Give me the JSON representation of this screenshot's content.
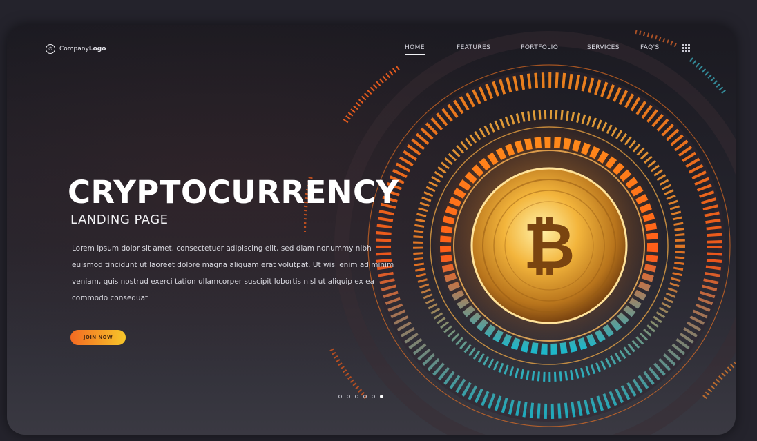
{
  "logo": {
    "text_regular": "Company",
    "text_bold": "Logo",
    "icon": "clock-icon"
  },
  "nav": {
    "items": [
      {
        "label": "HOME",
        "active": true
      },
      {
        "label": "FEATURES",
        "active": false
      },
      {
        "label": "PORTFOLIO",
        "active": false
      },
      {
        "label": "SERVICES",
        "active": false
      },
      {
        "label": "FAQ'S",
        "active": false
      }
    ],
    "menu_icon": "grid-icon"
  },
  "hero": {
    "title": "CRYPTOCURRENCY",
    "subtitle": "LANDING PAGE",
    "body": "Lorem ipsum dolor sit amet, consectetuer adipiscing elit, sed diam nonummy nibh euismod tincidunt ut laoreet dolore magna aliquam erat volutpat. Ut wisi enim ad minim veniam, quis nostrud exerci tation ullamcorper suscipit lobortis nisl ut aliquip ex ea commodo consequat",
    "button": "JOIN NOW",
    "coin_symbol": "₿"
  },
  "carousel": {
    "count": 6,
    "active_index": 5
  },
  "colors": {
    "accent_orange": "#f46a22",
    "accent_yellow": "#f6c62a",
    "accent_teal": "#2bb3c6",
    "gold": "#e8a93a"
  }
}
